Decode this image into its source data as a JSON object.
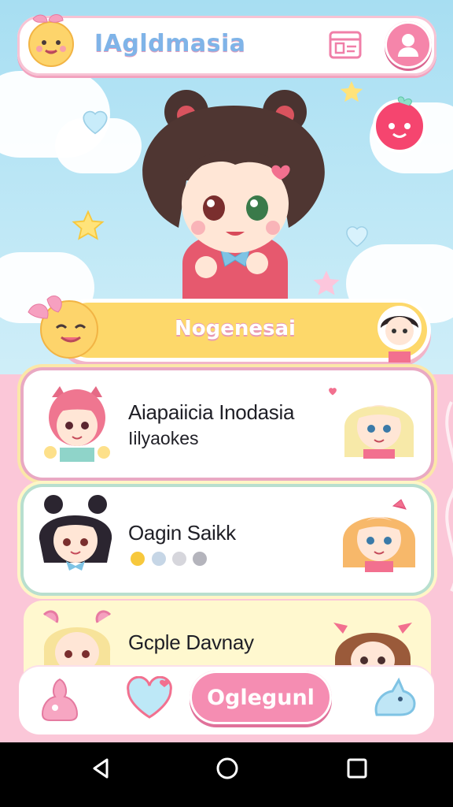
{
  "app": {
    "title": "IAgldmasia"
  },
  "header": {
    "icons": [
      "calendar-icon",
      "profile-icon",
      "strawberry-mascot-icon"
    ]
  },
  "banner": {
    "label": "Nogenesai"
  },
  "cards": [
    {
      "name": "Aiapaiicia Inodasia",
      "subtitle": "Iilyaokes"
    },
    {
      "name": "Oagin Saikk",
      "dots": 4,
      "active_dot": 0
    },
    {
      "name": "Gcple Davnay"
    }
  ],
  "bottom_nav": {
    "cta_label": "Oglegunl",
    "icons": [
      "home-icon",
      "heart-icon",
      "unicorn-icon"
    ]
  },
  "system_nav": {
    "icons": [
      "back-icon",
      "home-circle-icon",
      "recents-icon"
    ]
  },
  "colors": {
    "accent_pink": "#f58db2",
    "banner_yellow": "#fdd86a",
    "brand_blue": "#7fb4e8",
    "dot_active": "#f7c83c",
    "dot_inactive": "#c6d6e6"
  }
}
